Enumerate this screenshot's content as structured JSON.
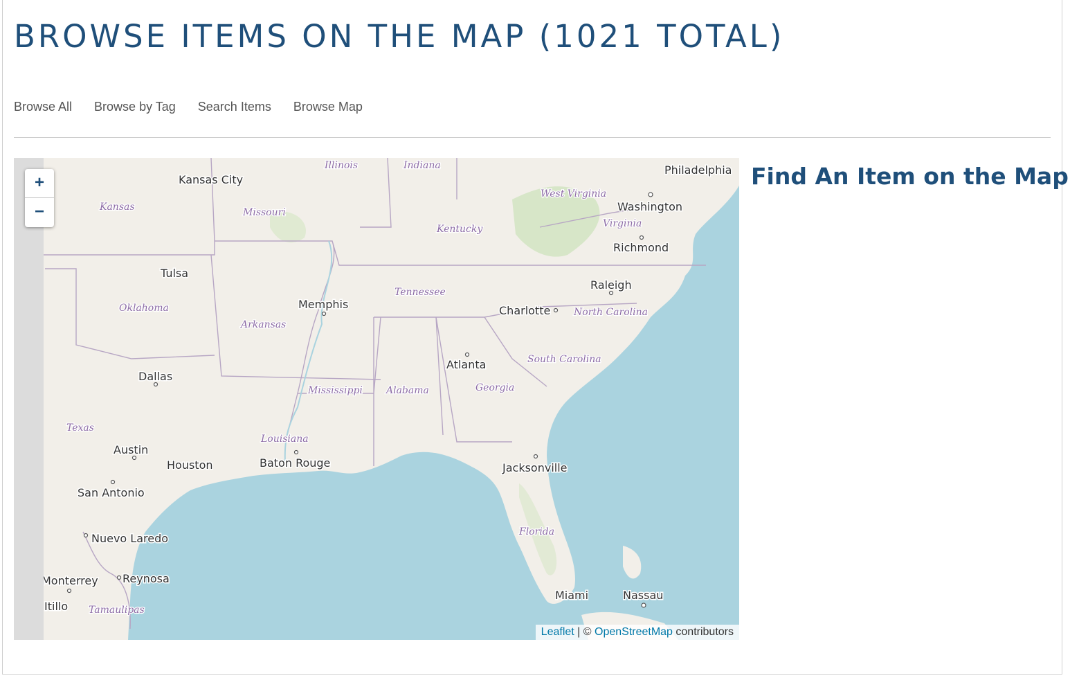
{
  "page": {
    "title": "BROWSE ITEMS ON THE MAP (1021 TOTAL)"
  },
  "nav": {
    "items": [
      {
        "label": "Browse All"
      },
      {
        "label": "Browse by Tag"
      },
      {
        "label": "Search Items"
      },
      {
        "label": "Browse Map"
      }
    ]
  },
  "map": {
    "zoom_in": "+",
    "zoom_out": "−",
    "attribution": {
      "leaflet": "Leaflet",
      "separator": " | © ",
      "osm": "OpenStreetMap",
      "suffix": " contributors"
    },
    "cities": [
      "Kansas City",
      "Philadelphia",
      "Washington",
      "Richmond",
      "Tulsa",
      "Memphis",
      "Raleigh",
      "Charlotte",
      "Atlanta",
      "Dallas",
      "Austin",
      "Houston",
      "Baton Rouge",
      "San Antonio",
      "Jacksonville",
      "Nuevo Laredo",
      "Monterrey",
      "Reynosa",
      "Miami",
      "Nassau",
      "Itillo"
    ],
    "states": [
      "Illinois",
      "Indiana",
      "Kansas",
      "Missouri",
      "West Virginia",
      "Virginia",
      "Kentucky",
      "Tennessee",
      "Oklahoma",
      "Arkansas",
      "North Carolina",
      "South Carolina",
      "Mississippi",
      "Alabama",
      "Georgia",
      "Texas",
      "Louisiana",
      "Florida",
      "Tamaulipas"
    ]
  },
  "sidebar": {
    "title": "Find An Item on the Map"
  },
  "colors": {
    "title": "#1f4f7a",
    "water": "#aad3df",
    "land": "#f2efe9",
    "link": "#0078a8"
  }
}
